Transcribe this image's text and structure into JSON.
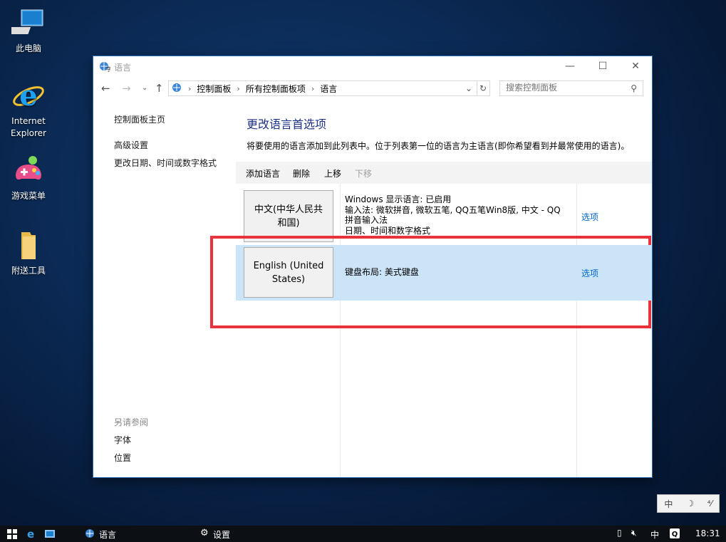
{
  "desktop": {
    "icons": [
      {
        "label": "此电脑"
      },
      {
        "label": "Internet\nExplorer",
        "line1": "Internet",
        "line2": "Explorer"
      },
      {
        "label": "游戏菜单"
      },
      {
        "label": "附送工具"
      }
    ]
  },
  "window": {
    "title": "语言",
    "controls": {
      "minimize": "—",
      "maximize": "☐",
      "close": "✕"
    },
    "breadcrumb": [
      "控制面板",
      "所有控制面板项",
      "语言"
    ],
    "search_placeholder": "搜索控制面板"
  },
  "left_pane": {
    "home_link": "控制面板主页",
    "links": [
      "高级设置",
      "更改日期、时间或数字格式"
    ],
    "see_also_title": "另请参阅",
    "see_also": [
      "字体",
      "位置"
    ]
  },
  "main": {
    "title": "更改语言首选项",
    "description": "将要使用的语言添加到此列表中。位于列表第一位的语言为主语言(即你希望看到并最常使用的语言)。",
    "toolbar": {
      "add": "添加语言",
      "remove": "删除",
      "up": "上移",
      "down": "下移"
    },
    "languages": [
      {
        "name": "中文(中华人民共和国)",
        "name_line1": "中文(中华人民共",
        "name_line2": "和国)",
        "info": [
          "Windows 显示语言: 已启用",
          "输入法: 微软拼音, 微软五笔, QQ五笔Win8版, 中文 - QQ",
          "拼音输入法",
          "日期、时间和数字格式"
        ],
        "options": "选项",
        "selected": false
      },
      {
        "name": "English (United States)",
        "name_line1": "English (United",
        "name_line2": "States)",
        "info": [
          "键盘布局: 美式键盘"
        ],
        "options": "选项",
        "selected": true
      }
    ]
  },
  "ime_bar": {
    "mode": "中",
    "punct": "☽",
    "width": "⁴⁄"
  },
  "taskbar": {
    "task_language": "语言",
    "task_settings": "设置",
    "tray_ime": "中",
    "clock": "18:31"
  },
  "colors": {
    "highlight": "#cce4f7",
    "link": "#0066cc",
    "title": "#1e3287",
    "annotation": "#e8323c"
  }
}
